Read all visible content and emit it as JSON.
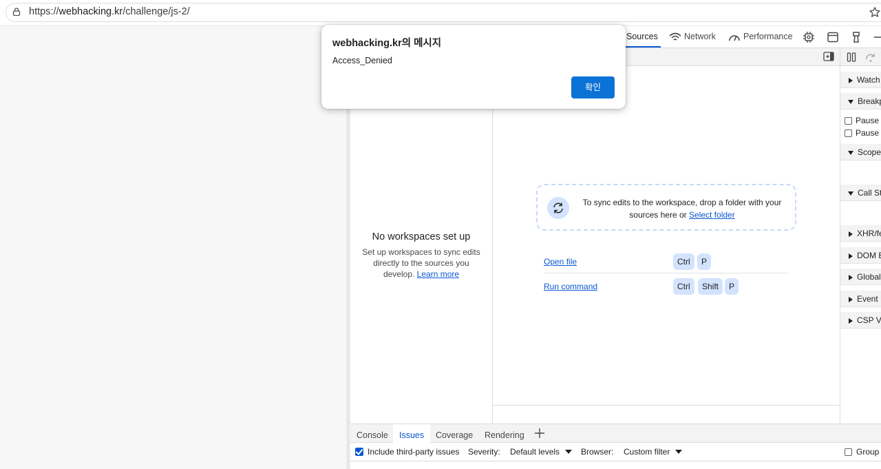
{
  "browser": {
    "url_prefix": "https://",
    "url_host": "webhacking.kr",
    "url_path": "/challenge/js-2/"
  },
  "devtools": {
    "tabs": [
      {
        "label": "Sources",
        "active": true
      },
      {
        "label": "Network",
        "active": false
      },
      {
        "label": "Performance",
        "active": false
      }
    ],
    "navigator": {
      "empty_title": "No workspaces set up",
      "empty_text": "Set up workspaces to sync edits directly to the sources you develop.",
      "learn_more": "Learn more"
    },
    "editor": {
      "drop_text": "To sync edits to the workspace, drop a folder with your sources here or",
      "select_folder": "Select folder",
      "shortcuts": [
        {
          "label": "Open file",
          "keys": [
            "Ctrl",
            "P"
          ]
        },
        {
          "label": "Run command",
          "keys": [
            "Ctrl",
            "Shift",
            "P"
          ]
        }
      ]
    },
    "debugger": {
      "watch": "Watch",
      "breakpoints": "Breakpoints",
      "pause_uncaught": "Pause on uncaught exceptions",
      "pause_caught": "Pause on caught exceptions",
      "scope": "Scope",
      "call_stack": "Call Stack",
      "xhr": "XHR/fetch Breakpoints",
      "dom": "DOM Breakpoints",
      "global": "Global Listeners",
      "event": "Event Listener Breakpoints",
      "csp": "CSP Violation Breakpoints"
    },
    "drawer": {
      "tabs": [
        {
          "label": "Console",
          "active": false
        },
        {
          "label": "Issues",
          "active": true
        },
        {
          "label": "Coverage",
          "active": false
        },
        {
          "label": "Rendering",
          "active": false
        }
      ],
      "include_third_party": "Include third-party issues",
      "severity_label": "Severity:",
      "severity_value": "Default levels",
      "browser_label": "Browser:",
      "browser_value": "Custom filter",
      "group_label": "Group by kind"
    }
  },
  "dialog": {
    "title": "webhacking.kr의 메시지",
    "message": "Access_Denied",
    "ok_label": "확인"
  },
  "colors": {
    "accent": "#0b57d0",
    "ok_button": "#0b72d6",
    "kbd_bg": "#d3e3fd"
  }
}
